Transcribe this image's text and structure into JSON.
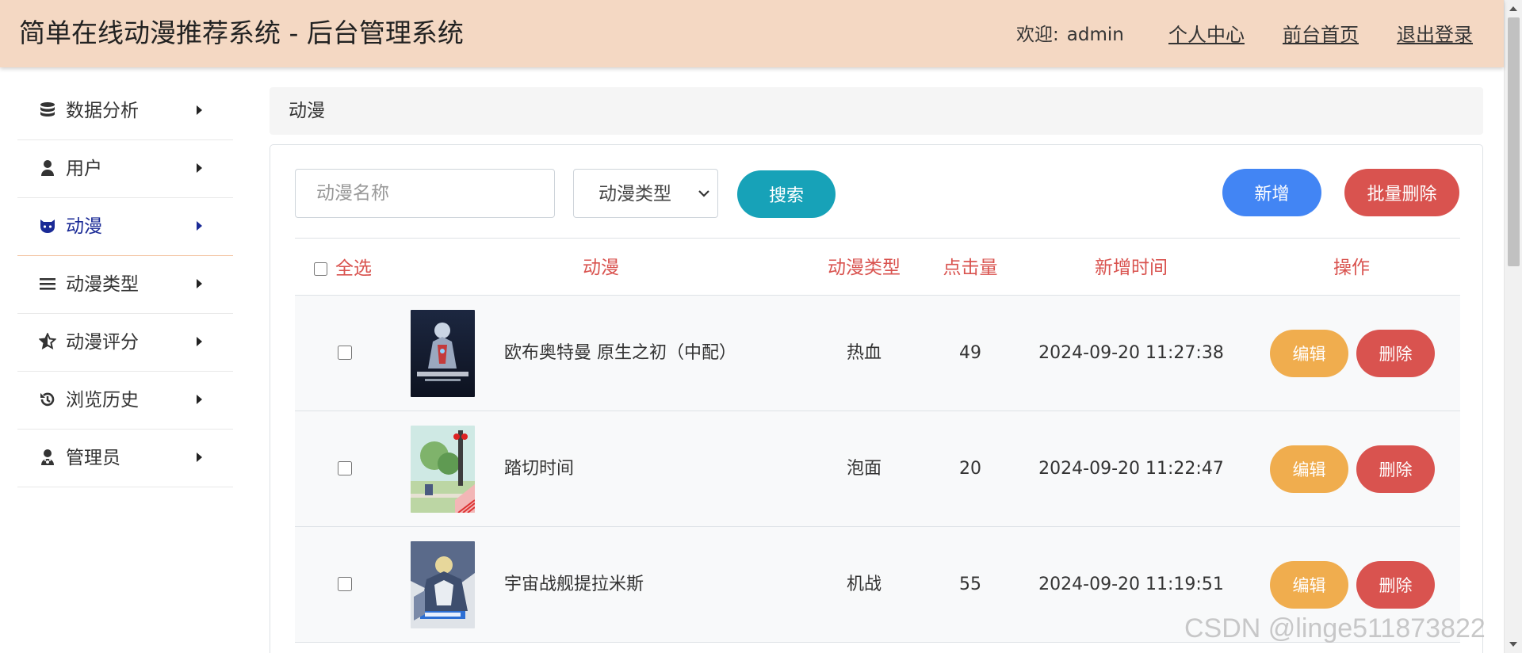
{
  "header": {
    "app_title": "简单在线动漫推荐系统 - 后台管理系统",
    "welcome_label": "欢迎:",
    "username": "admin",
    "links": {
      "profile": "个人中心",
      "frontend_home": "前台首页",
      "logout": "退出登录"
    },
    "background_color": "#f4d8c3"
  },
  "sidebar": {
    "items": [
      {
        "label": "数据分析",
        "icon": "database-icon",
        "active": false
      },
      {
        "label": "用户",
        "icon": "user-icon",
        "active": false
      },
      {
        "label": "动漫",
        "icon": "github-cat-icon",
        "active": true
      },
      {
        "label": "动漫类型",
        "icon": "bars-icon",
        "active": false
      },
      {
        "label": "动漫评分",
        "icon": "star-half-icon",
        "active": false
      },
      {
        "label": "浏览历史",
        "icon": "history-icon",
        "active": false
      },
      {
        "label": "管理员",
        "icon": "user-doctor-icon",
        "active": false
      }
    ],
    "active_color": "#1a2a96"
  },
  "breadcrumb": {
    "current": "动漫"
  },
  "toolbar": {
    "search_placeholder": "动漫名称",
    "type_select_value": "动漫类型",
    "search_button": "搜索",
    "add_button": "新增",
    "batch_delete_button": "批量删除"
  },
  "table": {
    "columns": {
      "select_all": "全选",
      "anime": "动漫",
      "type": "动漫类型",
      "clicks": "点击量",
      "created_at": "新增时间",
      "actions": "操作"
    },
    "header_color": "#d9534f",
    "rows": [
      {
        "name": "欧布奥特曼 原生之初（中配）",
        "type": "热血",
        "clicks": "49",
        "created_at": "2024-09-20 11:27:38"
      },
      {
        "name": "踏切时间",
        "type": "泡面",
        "clicks": "20",
        "created_at": "2024-09-20 11:22:47"
      },
      {
        "name": "宇宙战舰提拉米斯",
        "type": "机战",
        "clicks": "55",
        "created_at": "2024-09-20 11:19:51"
      }
    ],
    "row_actions": {
      "edit": "编辑",
      "delete": "删除"
    }
  },
  "colors": {
    "search_button": "#17a2b8",
    "add_button": "#4285f4",
    "delete_button": "#d9534f",
    "edit_button": "#f0ad4e"
  },
  "watermark": "CSDN @linge511873822"
}
